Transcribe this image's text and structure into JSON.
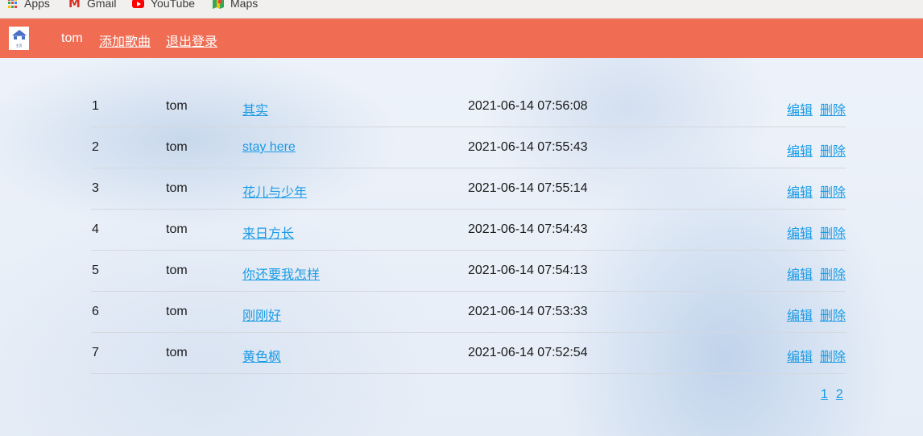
{
  "bookmarks": {
    "items": [
      {
        "label": "Apps",
        "icon": "apps-grid-icon"
      },
      {
        "label": "Gmail",
        "icon": "gmail-icon"
      },
      {
        "label": "YouTube",
        "icon": "youtube-icon"
      },
      {
        "label": "Maps",
        "icon": "maps-icon"
      }
    ]
  },
  "navbar": {
    "logo_text": "主页",
    "user": "tom",
    "add_song": "添加歌曲",
    "logout": "退出登录",
    "background_color": "#f06c53"
  },
  "songs": [
    {
      "id": "1",
      "user": "tom",
      "title": "其实",
      "time": "2021-06-14 07:56:08",
      "edit": "编辑",
      "delete": "删除"
    },
    {
      "id": "2",
      "user": "tom",
      "title": "stay here",
      "time": "2021-06-14 07:55:43",
      "edit": "编辑",
      "delete": "删除"
    },
    {
      "id": "3",
      "user": "tom",
      "title": "花儿与少年",
      "time": "2021-06-14 07:55:14",
      "edit": "编辑",
      "delete": "删除"
    },
    {
      "id": "4",
      "user": "tom",
      "title": "来日方长",
      "time": "2021-06-14 07:54:43",
      "edit": "编辑",
      "delete": "删除"
    },
    {
      "id": "5",
      "user": "tom",
      "title": "你还要我怎样",
      "time": "2021-06-14 07:54:13",
      "edit": "编辑",
      "delete": "删除"
    },
    {
      "id": "6",
      "user": "tom",
      "title": "刚刚好",
      "time": "2021-06-14 07:53:33",
      "edit": "编辑",
      "delete": "删除"
    },
    {
      "id": "7",
      "user": "tom",
      "title": "黄色枫",
      "time": "2021-06-14 07:52:54",
      "edit": "编辑",
      "delete": "删除"
    }
  ],
  "pagination": {
    "pages": [
      "1",
      "2"
    ]
  },
  "colors": {
    "link": "#1a9be6",
    "text": "#1a1a1a"
  }
}
